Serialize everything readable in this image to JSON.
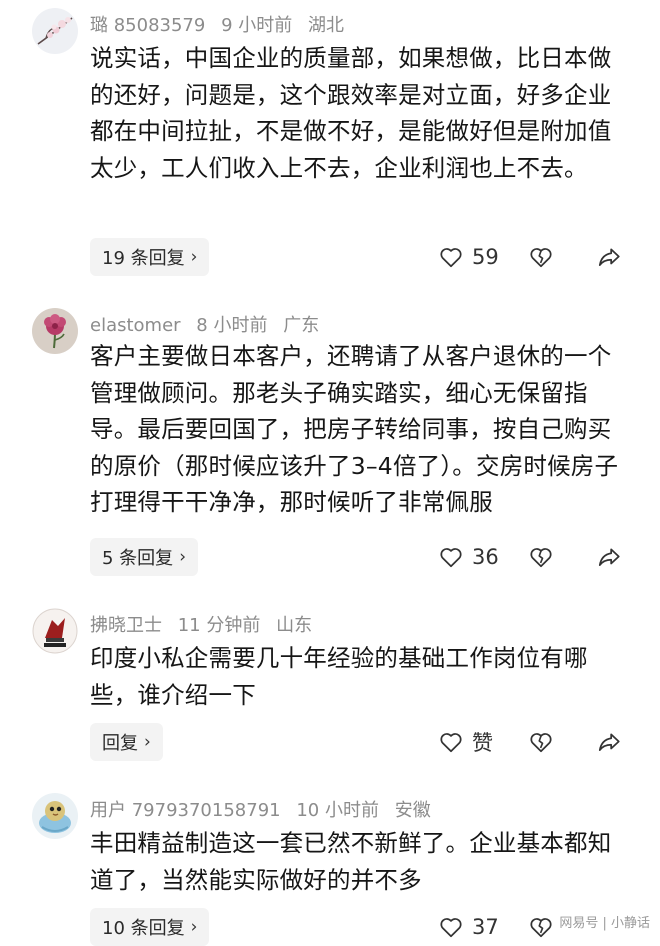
{
  "comments": [
    {
      "user": "璐 85083579",
      "time": "9 小时前",
      "location": "湖北",
      "avatar": "flower-branch-avatar",
      "text": "说实话，中国企业的质量部，如果想做，比日本做的还好，问题是，这个跟效率是对立面，好多企业都在中间拉扯，不是做不好，是能做好但是附加值太少，工人们收入上不去，企业利润也上不去。",
      "reply_label": "19 条回复",
      "like_count": "59"
    },
    {
      "user": "elastomer",
      "time": "8 小时前",
      "location": "广东",
      "avatar": "pink-flower-avatar",
      "text": "客户主要做日本客户，还聘请了从客户退休的一个管理做顾问。那老头子确实踏实，细心无保留指导。最后要回国了，把房子转给同事，按自己购买的原价（那时候应该升了3–4倍了）。交房时候房子打理得干干净净，那时候听了非常佩服",
      "reply_label": "5 条回复",
      "like_count": "36"
    },
    {
      "user": "拂晓卫士",
      "time": "11 分钟前",
      "location": "山东",
      "avatar": "emblem-avatar",
      "text": "印度小私企需要几十年经验的基础工作岗位有哪些，谁介绍一下",
      "reply_label": "回复",
      "like_count": "赞"
    },
    {
      "user": "用户 7979370158791",
      "time": "10 小时前",
      "location": "安徽",
      "avatar": "cartoon-bird-avatar",
      "text": "丰田精益制造这一套已然不新鲜了。企业基本都知道了，当然能实际做好的并不多",
      "reply_label": "10 条回复",
      "like_count": "37"
    }
  ],
  "icons": {
    "like": "heart-outline-icon",
    "dislike": "broken-heart-outline-icon",
    "share": "share-arrow-icon",
    "chevron": "chevron-right-icon"
  },
  "watermark": "网易号 | 小静话"
}
